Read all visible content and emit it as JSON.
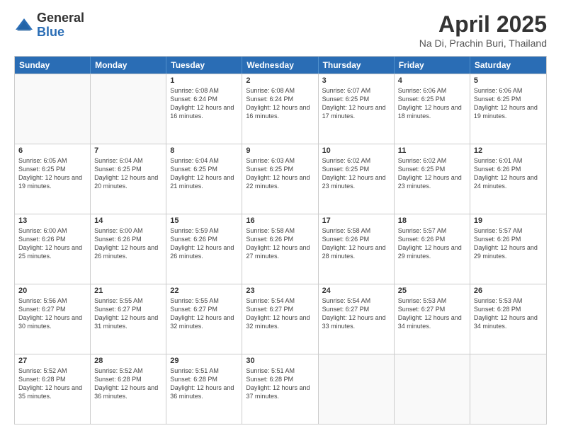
{
  "logo": {
    "general": "General",
    "blue": "Blue"
  },
  "title": "April 2025",
  "subtitle": "Na Di, Prachin Buri, Thailand",
  "days": [
    "Sunday",
    "Monday",
    "Tuesday",
    "Wednesday",
    "Thursday",
    "Friday",
    "Saturday"
  ],
  "weeks": [
    [
      {
        "day": "",
        "text": ""
      },
      {
        "day": "",
        "text": ""
      },
      {
        "day": "1",
        "text": "Sunrise: 6:08 AM\nSunset: 6:24 PM\nDaylight: 12 hours and 16 minutes."
      },
      {
        "day": "2",
        "text": "Sunrise: 6:08 AM\nSunset: 6:24 PM\nDaylight: 12 hours and 16 minutes."
      },
      {
        "day": "3",
        "text": "Sunrise: 6:07 AM\nSunset: 6:25 PM\nDaylight: 12 hours and 17 minutes."
      },
      {
        "day": "4",
        "text": "Sunrise: 6:06 AM\nSunset: 6:25 PM\nDaylight: 12 hours and 18 minutes."
      },
      {
        "day": "5",
        "text": "Sunrise: 6:06 AM\nSunset: 6:25 PM\nDaylight: 12 hours and 19 minutes."
      }
    ],
    [
      {
        "day": "6",
        "text": "Sunrise: 6:05 AM\nSunset: 6:25 PM\nDaylight: 12 hours and 19 minutes."
      },
      {
        "day": "7",
        "text": "Sunrise: 6:04 AM\nSunset: 6:25 PM\nDaylight: 12 hours and 20 minutes."
      },
      {
        "day": "8",
        "text": "Sunrise: 6:04 AM\nSunset: 6:25 PM\nDaylight: 12 hours and 21 minutes."
      },
      {
        "day": "9",
        "text": "Sunrise: 6:03 AM\nSunset: 6:25 PM\nDaylight: 12 hours and 22 minutes."
      },
      {
        "day": "10",
        "text": "Sunrise: 6:02 AM\nSunset: 6:25 PM\nDaylight: 12 hours and 23 minutes."
      },
      {
        "day": "11",
        "text": "Sunrise: 6:02 AM\nSunset: 6:25 PM\nDaylight: 12 hours and 23 minutes."
      },
      {
        "day": "12",
        "text": "Sunrise: 6:01 AM\nSunset: 6:26 PM\nDaylight: 12 hours and 24 minutes."
      }
    ],
    [
      {
        "day": "13",
        "text": "Sunrise: 6:00 AM\nSunset: 6:26 PM\nDaylight: 12 hours and 25 minutes."
      },
      {
        "day": "14",
        "text": "Sunrise: 6:00 AM\nSunset: 6:26 PM\nDaylight: 12 hours and 26 minutes."
      },
      {
        "day": "15",
        "text": "Sunrise: 5:59 AM\nSunset: 6:26 PM\nDaylight: 12 hours and 26 minutes."
      },
      {
        "day": "16",
        "text": "Sunrise: 5:58 AM\nSunset: 6:26 PM\nDaylight: 12 hours and 27 minutes."
      },
      {
        "day": "17",
        "text": "Sunrise: 5:58 AM\nSunset: 6:26 PM\nDaylight: 12 hours and 28 minutes."
      },
      {
        "day": "18",
        "text": "Sunrise: 5:57 AM\nSunset: 6:26 PM\nDaylight: 12 hours and 29 minutes."
      },
      {
        "day": "19",
        "text": "Sunrise: 5:57 AM\nSunset: 6:26 PM\nDaylight: 12 hours and 29 minutes."
      }
    ],
    [
      {
        "day": "20",
        "text": "Sunrise: 5:56 AM\nSunset: 6:27 PM\nDaylight: 12 hours and 30 minutes."
      },
      {
        "day": "21",
        "text": "Sunrise: 5:55 AM\nSunset: 6:27 PM\nDaylight: 12 hours and 31 minutes."
      },
      {
        "day": "22",
        "text": "Sunrise: 5:55 AM\nSunset: 6:27 PM\nDaylight: 12 hours and 32 minutes."
      },
      {
        "day": "23",
        "text": "Sunrise: 5:54 AM\nSunset: 6:27 PM\nDaylight: 12 hours and 32 minutes."
      },
      {
        "day": "24",
        "text": "Sunrise: 5:54 AM\nSunset: 6:27 PM\nDaylight: 12 hours and 33 minutes."
      },
      {
        "day": "25",
        "text": "Sunrise: 5:53 AM\nSunset: 6:27 PM\nDaylight: 12 hours and 34 minutes."
      },
      {
        "day": "26",
        "text": "Sunrise: 5:53 AM\nSunset: 6:28 PM\nDaylight: 12 hours and 34 minutes."
      }
    ],
    [
      {
        "day": "27",
        "text": "Sunrise: 5:52 AM\nSunset: 6:28 PM\nDaylight: 12 hours and 35 minutes."
      },
      {
        "day": "28",
        "text": "Sunrise: 5:52 AM\nSunset: 6:28 PM\nDaylight: 12 hours and 36 minutes."
      },
      {
        "day": "29",
        "text": "Sunrise: 5:51 AM\nSunset: 6:28 PM\nDaylight: 12 hours and 36 minutes."
      },
      {
        "day": "30",
        "text": "Sunrise: 5:51 AM\nSunset: 6:28 PM\nDaylight: 12 hours and 37 minutes."
      },
      {
        "day": "",
        "text": ""
      },
      {
        "day": "",
        "text": ""
      },
      {
        "day": "",
        "text": ""
      }
    ]
  ]
}
